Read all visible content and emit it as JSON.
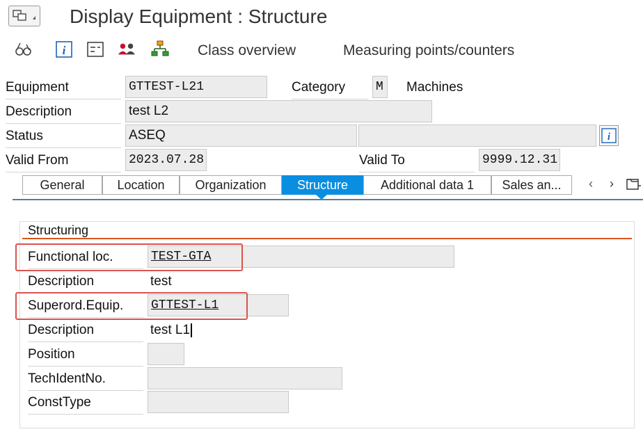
{
  "window": {
    "title": "Display Equipment : Structure"
  },
  "toolbar": {
    "icons": [
      "glasses-icon",
      "info-icon",
      "display-fields-icon",
      "partners-icon",
      "hierarchy-icon"
    ],
    "class_overview": "Class overview",
    "measuring_points": "Measuring points/counters"
  },
  "header": {
    "equipment_label": "Equipment",
    "equipment_value": "GTTEST-L21",
    "category_label": "Category",
    "category_value": "M",
    "category_text": "Machines",
    "description_label": "Description",
    "description_value": "test L2",
    "status_label": "Status",
    "status_value": "ASEQ",
    "status_value2": "",
    "valid_from_label": "Valid From",
    "valid_from_value": "2023.07.28",
    "valid_to_label": "Valid To",
    "valid_to_value": "9999.12.31"
  },
  "tabs": [
    {
      "label": "General",
      "active": false
    },
    {
      "label": "Location",
      "active": false
    },
    {
      "label": "Organization",
      "active": false
    },
    {
      "label": "Structure",
      "active": true
    },
    {
      "label": "Additional data 1",
      "active": false
    },
    {
      "label": "Sales an...",
      "active": false
    }
  ],
  "structure": {
    "group_title": "Structuring",
    "functional_loc_label": "Functional loc.",
    "functional_loc_value": "TEST-GTA",
    "description1_label": "Description",
    "description1_value": "test",
    "superord_label": "Superord.Equip.",
    "superord_value": "GTTEST-L1",
    "description2_label": "Description",
    "description2_value": "test L1",
    "position_label": "Position",
    "position_value": "",
    "techident_label": "TechIdentNo.",
    "techident_value": "",
    "consttype_label": "ConstType",
    "consttype_value": ""
  },
  "colors": {
    "accent": "#0a8ee0",
    "highlight": "#d9534f",
    "group_rule": "#d9541a"
  }
}
